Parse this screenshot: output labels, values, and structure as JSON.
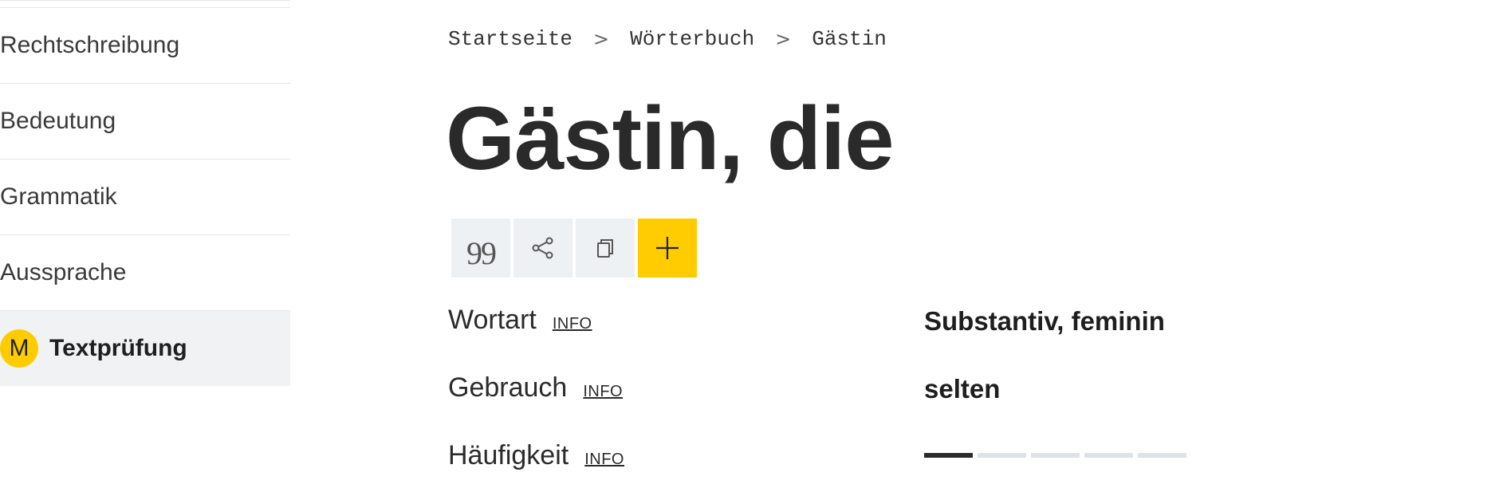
{
  "sidebar": {
    "items": [
      {
        "label": "Rechtschreibung"
      },
      {
        "label": "Bedeutung"
      },
      {
        "label": "Grammatik"
      },
      {
        "label": "Aussprache"
      }
    ],
    "active": {
      "badge": "M",
      "label": "Textprüfung"
    }
  },
  "breadcrumb": {
    "items": [
      "Startseite",
      "Wörterbuch",
      "Gästin"
    ],
    "separator": ">"
  },
  "title": "Gästin, die",
  "toolbar": {
    "buttons": [
      {
        "icon": "quote-icon",
        "glyph": "99"
      },
      {
        "icon": "share-icon"
      },
      {
        "icon": "copy-icon"
      },
      {
        "icon": "plus-icon"
      }
    ],
    "accent": "#fecc00"
  },
  "facts": {
    "wortart": {
      "label": "Wortart",
      "info": "INFO",
      "value": "Substantiv, feminin"
    },
    "gebrauch": {
      "label": "Gebrauch",
      "info": "INFO",
      "value": "selten"
    },
    "haeufigkeit": {
      "label": "Häufigkeit",
      "info": "INFO",
      "level": 1,
      "max": 5
    }
  }
}
